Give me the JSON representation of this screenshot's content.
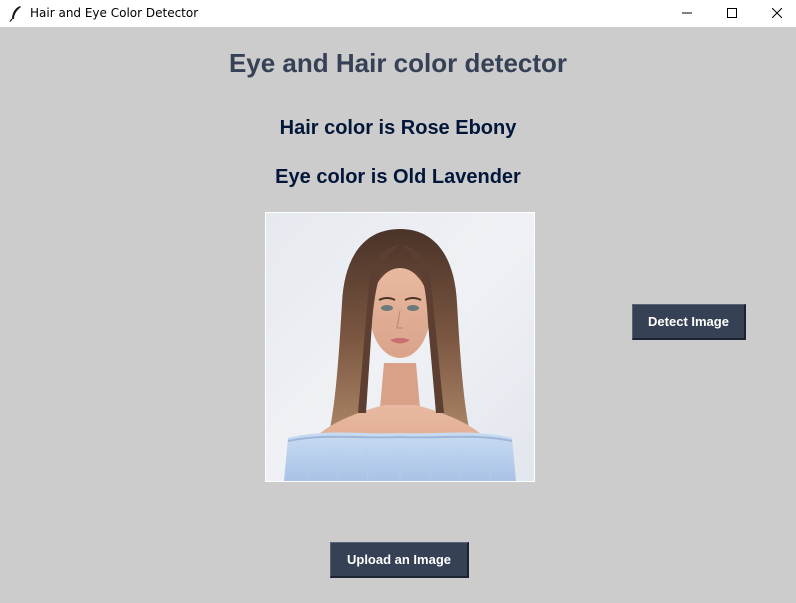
{
  "window": {
    "title": "Hair and Eye Color Detector"
  },
  "heading": "Eye and Hair color detector",
  "results": {
    "hair": "Hair color is Rose Ebony",
    "eye": "Eye color is Old Lavender"
  },
  "buttons": {
    "detect": "Detect Image",
    "upload": "Upload an Image"
  },
  "icons": {
    "app": "feather-icon",
    "minimize": "minimize-icon",
    "maximize": "maximize-icon",
    "close": "close-icon"
  },
  "colors": {
    "background": "#cccccc",
    "heading": "#364156",
    "result_text": "#011638",
    "button_bg": "#364156",
    "button_text": "#ffffff"
  }
}
